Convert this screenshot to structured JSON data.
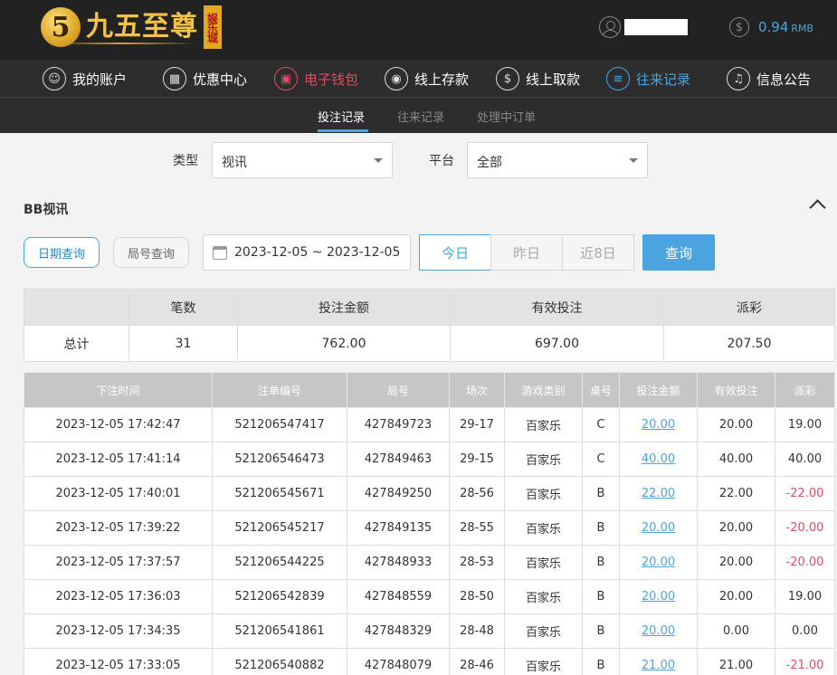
{
  "header": {
    "logo_digit": "5",
    "logo_text": "九五至尊",
    "logo_tag": "娱乐城",
    "balance_value": "0.94",
    "balance_currency": "RMB"
  },
  "nav": [
    {
      "label": "我的账户",
      "icon": "user-icon"
    },
    {
      "label": "优惠中心",
      "icon": "gift-icon"
    },
    {
      "label": "电子钱包",
      "icon": "wallet-icon"
    },
    {
      "label": "线上存款",
      "icon": "deposit-icon"
    },
    {
      "label": "线上取款",
      "icon": "withdraw-icon"
    },
    {
      "label": "往来记录",
      "icon": "records-icon"
    },
    {
      "label": "信息公告",
      "icon": "bell-icon"
    }
  ],
  "subtabs": [
    "投注记录",
    "往来记录",
    "处理中订单"
  ],
  "filters": {
    "type_label": "类型",
    "type_value": "视讯",
    "platform_label": "平台",
    "platform_value": "全部"
  },
  "section_title": "BB视讯",
  "query": {
    "date_query": "日期查询",
    "round_query": "局号查询",
    "date_range": "2023-12-05 ~ 2023-12-05",
    "today": "今日",
    "yesterday": "昨日",
    "last8": "近8日",
    "submit": "查询"
  },
  "summary": {
    "headers": [
      "",
      "笔数",
      "投注金额",
      "有效投注",
      "派彩"
    ],
    "row": [
      "总计",
      "31",
      "762.00",
      "697.00",
      "207.50"
    ]
  },
  "records": {
    "headers": [
      "下注时间",
      "注单编号",
      "局号",
      "场次",
      "游戏类别",
      "桌号",
      "投注金额",
      "有效投注",
      "派彩"
    ],
    "rows": [
      [
        "2023-12-05 17:42:47",
        "521206547417",
        "427849723",
        "29-17",
        "百家乐",
        "C",
        "20.00",
        "20.00",
        "19.00"
      ],
      [
        "2023-12-05 17:41:14",
        "521206546473",
        "427849463",
        "29-15",
        "百家乐",
        "C",
        "40.00",
        "40.00",
        "40.00"
      ],
      [
        "2023-12-05 17:40:01",
        "521206545671",
        "427849250",
        "28-56",
        "百家乐",
        "B",
        "22.00",
        "22.00",
        "-22.00"
      ],
      [
        "2023-12-05 17:39:22",
        "521206545217",
        "427849135",
        "28-55",
        "百家乐",
        "B",
        "20.00",
        "20.00",
        "-20.00"
      ],
      [
        "2023-12-05 17:37:57",
        "521206544225",
        "427848933",
        "28-53",
        "百家乐",
        "B",
        "20.00",
        "20.00",
        "-20.00"
      ],
      [
        "2023-12-05 17:36:03",
        "521206542839",
        "427848559",
        "28-50",
        "百家乐",
        "B",
        "20.00",
        "20.00",
        "19.00"
      ],
      [
        "2023-12-05 17:34:35",
        "521206541861",
        "427848329",
        "28-48",
        "百家乐",
        "B",
        "20.00",
        "0.00",
        "0.00"
      ],
      [
        "2023-12-05 17:33:05",
        "521206540882",
        "427848079",
        "28-46",
        "百家乐",
        "B",
        "21.00",
        "21.00",
        "-21.00"
      ]
    ]
  },
  "colors": {
    "accent": "#4aa5de",
    "negative": "#e24b62",
    "header_bg": "#222222"
  }
}
